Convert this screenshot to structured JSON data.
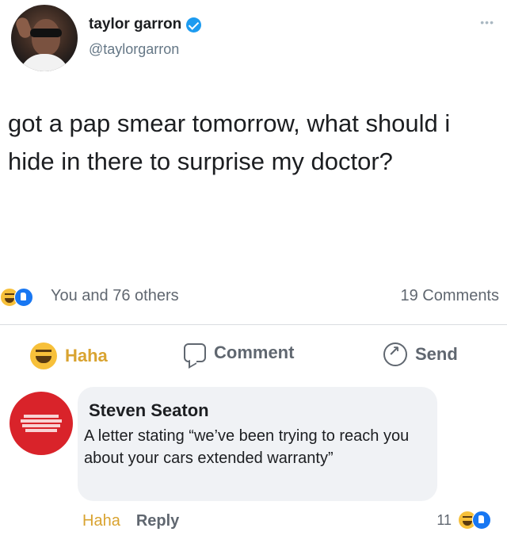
{
  "tweet": {
    "display_name": "taylor garron",
    "handle": "@taylorgarron",
    "more": "•••",
    "text": "got a pap smear tomorrow, what should i hide in there to surprise my doctor?"
  },
  "reactions": {
    "summary": "You and 76 others",
    "comments": "19 Comments"
  },
  "actions": {
    "haha": "Haha",
    "comment": "Comment",
    "send": "Send"
  },
  "comment": {
    "author": "Steven Seaton",
    "text": "A letter stating “we’ve been trying to reach you about your cars extended warranty”",
    "haha_label": "Haha",
    "reply_label": "Reply",
    "reaction_count": "11"
  },
  "colors": {
    "haha_accent": "#d9a330",
    "like_blue": "#1877f2",
    "verified_blue": "#1d9bf0",
    "bubble_bg": "#f0f2f5"
  }
}
